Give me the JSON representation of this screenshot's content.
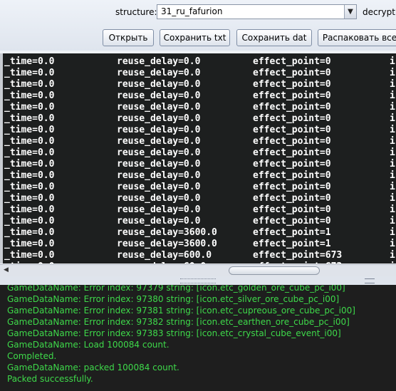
{
  "toolbar": {
    "structure_label": "structure:",
    "structure_value": "31_ru_fafurion",
    "decrypt_label": "decrypt:",
    "buttons": [
      "Открыть",
      "Сохранить txt",
      "Сохранить dat",
      "Распаковать все"
    ]
  },
  "rows": [
    [
      "_time=0.0",
      "reuse_delay=0.0",
      "effect_point=0",
      "is"
    ],
    [
      "_time=0.0",
      "reuse_delay=0.0",
      "effect_point=0",
      "is"
    ],
    [
      "_time=0.0",
      "reuse_delay=0.0",
      "effect_point=0",
      "is"
    ],
    [
      "_time=0.0",
      "reuse_delay=0.0",
      "effect_point=0",
      "is"
    ],
    [
      "_time=0.0",
      "reuse_delay=0.0",
      "effect_point=0",
      "is"
    ],
    [
      "_time=0.0",
      "reuse_delay=0.0",
      "effect_point=0",
      "is"
    ],
    [
      "_time=0.0",
      "reuse_delay=0.0",
      "effect_point=0",
      "is"
    ],
    [
      "_time=0.0",
      "reuse_delay=0.0",
      "effect_point=0",
      "is"
    ],
    [
      "_time=0.0",
      "reuse_delay=0.0",
      "effect_point=0",
      "is"
    ],
    [
      "_time=0.0",
      "reuse_delay=0.0",
      "effect_point=0",
      "is"
    ],
    [
      "_time=0.0",
      "reuse_delay=0.0",
      "effect_point=0",
      "is"
    ],
    [
      "_time=0.0",
      "reuse_delay=0.0",
      "effect_point=0",
      "is"
    ],
    [
      "_time=0.0",
      "reuse_delay=0.0",
      "effect_point=0",
      "is"
    ],
    [
      "_time=0.0",
      "reuse_delay=0.0",
      "effect_point=0",
      "is"
    ],
    [
      "_time=0.0",
      "reuse_delay=0.0",
      "effect_point=0",
      "is"
    ],
    [
      "_time=0.0",
      "reuse_delay=3600.0",
      "effect_point=1",
      "is"
    ],
    [
      "_time=0.0",
      "reuse_delay=3600.0",
      "effect_point=1",
      "is"
    ],
    [
      "_time=0.0",
      "reuse_delay=600.0",
      "effect_point=673",
      "is"
    ],
    [
      "_time=0.0",
      "reuse_delay=60.0",
      "effect_point=673",
      "is"
    ]
  ],
  "log": [
    "GameDataName: Error index: 97379 string: [icon.etc_golden_ore_cube_pc_i00]",
    "GameDataName: Error index: 97380 string: [icon.etc_silver_ore_cube_pc_i00]",
    "GameDataName: Error index: 97381 string: [icon.etc_cupreous_ore_cube_pc_i00]",
    "GameDataName: Error index: 97382 string: [icon.etc_earthen_ore_cube_pc_i00]",
    "GameDataName: Error index: 97383 string: [icon.etc_crystal_cube_event_i00]",
    "GameDataName: Load 100084 count.",
    "Completed.",
    "GameDataName: packed 100084 count.",
    "Packed successfully."
  ],
  "icons": {
    "dropdown": "chevron-down-icon",
    "scroll_left": "arrow-left-icon"
  }
}
